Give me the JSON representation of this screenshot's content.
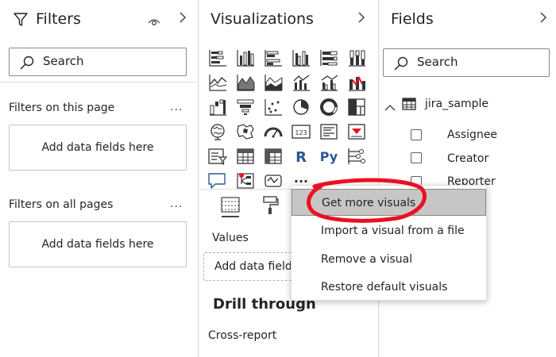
{
  "filters": {
    "title": "Filters",
    "search_placeholder": "Search",
    "on_this_page": "Filters on this page",
    "on_all_pages": "Filters on all pages",
    "drop_text_1": "Add data fields here",
    "drop_text_2": "Add data fields here",
    "more": "...",
    "icons": [
      "filter-icon",
      "eye-icon",
      "chevron-right-icon"
    ]
  },
  "visualizations": {
    "title": "Visualizations",
    "values_label": "Values",
    "add_fields": "Add data fields",
    "drill_through": "Drill through",
    "cross_report": "Cross-report",
    "r_label": "R",
    "py_label": "Py",
    "more_label": "...",
    "num_label": "123",
    "icons": [
      "stacked-bar-icon",
      "stacked-column-icon",
      "clustered-bar-icon",
      "clustered-column-icon",
      "100-bar-icon",
      "100-column-icon",
      "line-icon",
      "area-icon",
      "stacked-area-icon",
      "line-column-icon",
      "line-clustered-column-icon",
      "ribbon-icon",
      "waterfall-icon",
      "funnel-icon",
      "scatter-icon",
      "pie-icon",
      "donut-icon",
      "treemap-icon",
      "map-icon",
      "filled-map-icon",
      "gauge-icon",
      "card-icon",
      "multirow-card-icon",
      "kpi-icon",
      "slicer-icon",
      "table-icon",
      "matrix-icon",
      "r-visual-icon",
      "python-visual-icon",
      "key-influencers-icon",
      "qa-icon",
      "decomposition-tree-icon",
      "smart-narrative-icon",
      "more-visuals-icon"
    ]
  },
  "fields": {
    "title": "Fields",
    "search_placeholder": "Search",
    "table_name": "jira_sample",
    "items": [
      "Assignee",
      "Creator",
      "Reporter"
    ]
  },
  "context_menu": {
    "items": [
      "Get more visuals",
      "Import a visual from a file",
      "Remove a visual",
      "Restore default visuals"
    ],
    "highlighted": "Get more visuals"
  },
  "colors": {
    "accent": "#118dff",
    "annotation": "#e81123",
    "menu_highlight": "#c8c6c4"
  }
}
